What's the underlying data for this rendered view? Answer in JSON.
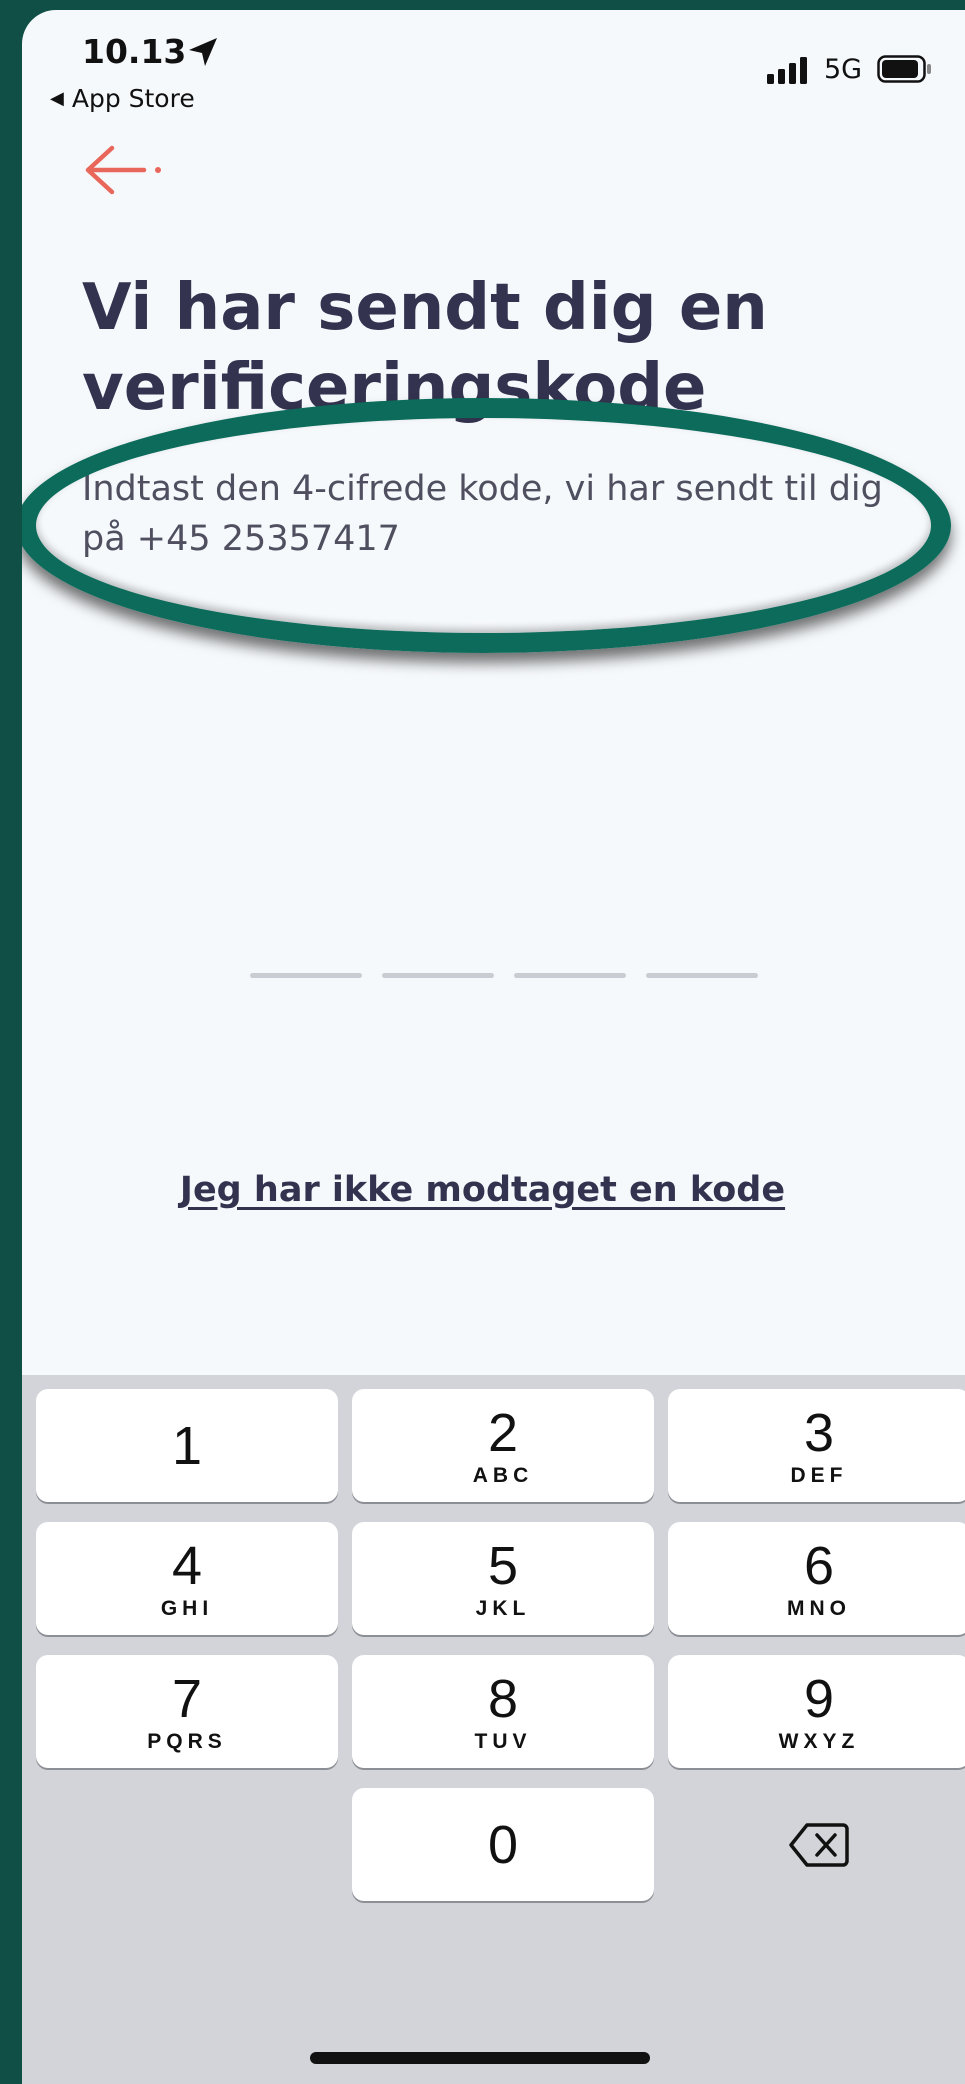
{
  "status_bar": {
    "time": "10.13",
    "back_app": "App Store",
    "network": "5G"
  },
  "header": {
    "title_line1": "Vi har sendt dig en",
    "title_line2": "verificeringskode",
    "subtitle_line1": "Indtast den 4-cifrede kode, vi har sendt til dig",
    "subtitle_line2": "på +45 25357417"
  },
  "code_input": {
    "length": 4
  },
  "links": {
    "no_code": "Jeg har ikke modtaget en kode"
  },
  "keypad": {
    "keys": [
      {
        "digit": "1",
        "letters": ""
      },
      {
        "digit": "2",
        "letters": "ABC"
      },
      {
        "digit": "3",
        "letters": "DEF"
      },
      {
        "digit": "4",
        "letters": "GHI"
      },
      {
        "digit": "5",
        "letters": "JKL"
      },
      {
        "digit": "6",
        "letters": "MNO"
      },
      {
        "digit": "7",
        "letters": "PQRS"
      },
      {
        "digit": "8",
        "letters": "TUV"
      },
      {
        "digit": "9",
        "letters": "WXYZ"
      },
      {
        "digit": "0",
        "letters": ""
      }
    ]
  },
  "colors": {
    "accent": "#e8675a",
    "text_dark": "#33334f",
    "highlight_ring": "#0c6b5b"
  }
}
